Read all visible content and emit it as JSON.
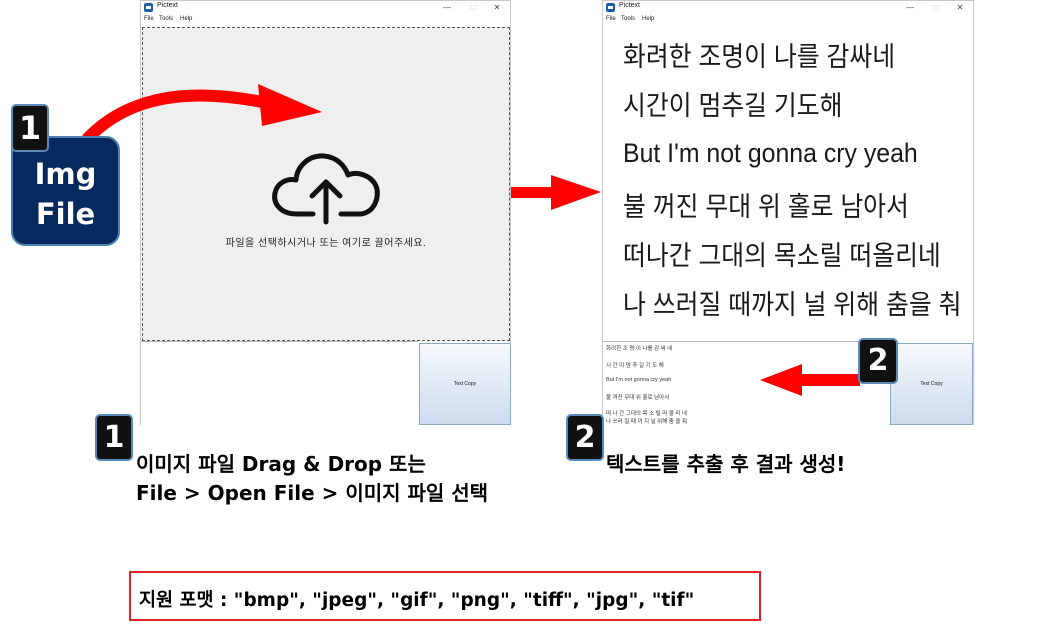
{
  "left_window": {
    "title": "Pictext",
    "menu": [
      "File",
      "Tools",
      "Help"
    ],
    "drop_hint": "파일을 선택하시거나 또는 여기로 끌어주세요.",
    "copy_button": "Text Copy"
  },
  "right_window": {
    "title": "Pictext",
    "menu": [
      "File",
      "Tools",
      "Help"
    ],
    "lyrics": [
      "화려한 조명이 나를 감싸네",
      "시간이 멈추길 기도해",
      "But I'm not gonna cry yeah",
      "불 꺼진 무대 위 홀로 남아서",
      "떠나간 그대의 목소릴 떠올리네",
      "나 쓰러질 때까지 널 위해 춤을 춰"
    ],
    "extracted_lines": [
      "화려한 조 명 이 나를 감 싸 네",
      "시 간 이 멈 추 길 기 도 해",
      "But I'm not gonna cry yeah",
      "불 꺼진 무대 위 홀로 남아서",
      "떠 나 간 그대의 목 소 릴 떠 올 리 네",
      "나 쓰러 질 때 까 지 널 위해 춤 을 춰"
    ],
    "copy_button": "Text Copy"
  },
  "annotations": {
    "img_file_line1": "Img",
    "img_file_line2": "File",
    "badge1": "1",
    "badge2": "2",
    "step1_line1": "이미지 파일 Drag & Drop 또는",
    "step1_line2": "File > Open File > 이미지 파일 선택",
    "step2": "텍스트를 추출 후 결과 생성!",
    "formats": "지원 포맷 : \"bmp\", \"jpeg\", \"gif\", \"png\", \"tiff\", \"jpg\", \"tif\""
  },
  "colors": {
    "arrow": "#ff0000",
    "badge_bg": "#111111",
    "img_file_bg": "#062a5e",
    "format_border": "#e0232a"
  }
}
